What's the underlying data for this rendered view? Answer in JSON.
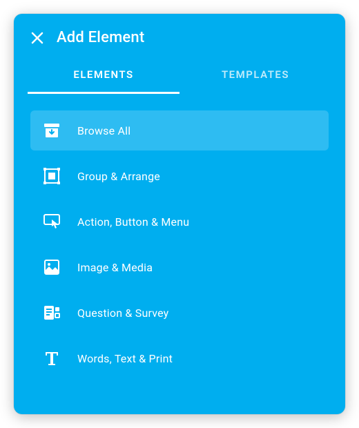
{
  "header": {
    "title": "Add Element"
  },
  "tabs": [
    {
      "label": "ELEMENTS",
      "active": true
    },
    {
      "label": "TEMPLATES",
      "active": false
    }
  ],
  "items": [
    {
      "icon": "archive-down-icon",
      "label": "Browse All",
      "active": true
    },
    {
      "icon": "group-arrange-icon",
      "label": "Group & Arrange",
      "active": false
    },
    {
      "icon": "action-button-icon",
      "label": "Action, Button & Menu",
      "active": false
    },
    {
      "icon": "image-media-icon",
      "label": "Image & Media",
      "active": false
    },
    {
      "icon": "question-survey-icon",
      "label": "Question & Survey",
      "active": false
    },
    {
      "icon": "text-icon",
      "label": "Words, Text & Print",
      "active": false
    }
  ],
  "colors": {
    "background": "#00aeef",
    "text": "#ffffff"
  }
}
